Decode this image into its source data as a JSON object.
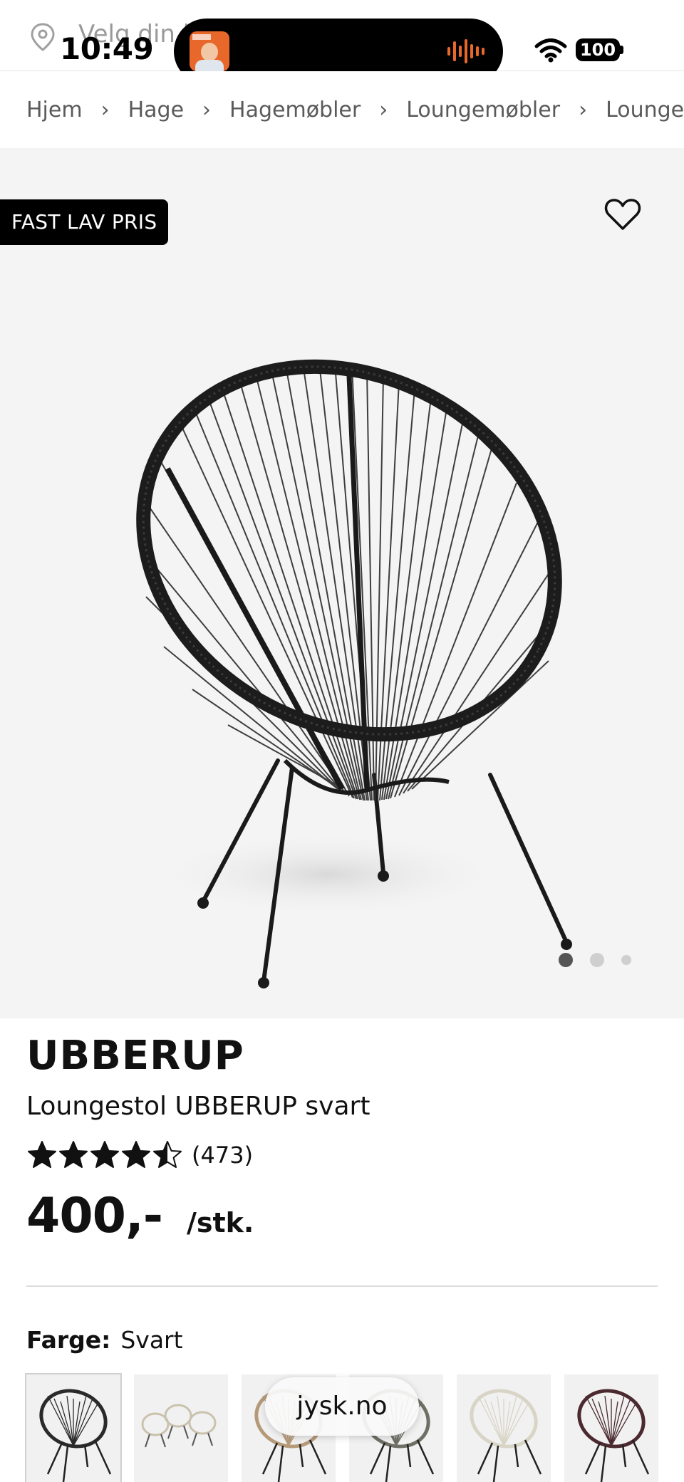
{
  "status_bar": {
    "time": "10:49",
    "battery": "100",
    "location_prompt": "Velg din b"
  },
  "breadcrumb": [
    "Hjem",
    "Hage",
    "Hagemøbler",
    "Loungemøbler",
    "Loungestoler"
  ],
  "breadcrumb_separator": "›",
  "hero": {
    "badge": "FAST LAV PRIS",
    "image_count": 3,
    "active_image": 1,
    "icons": [
      "heart-outline-icon",
      "location-pin-icon"
    ]
  },
  "product": {
    "brand": "UBBERUP",
    "name": "Loungestol UBBERUP svart",
    "rating": 4.5,
    "rating_max": 5,
    "review_count": "(473)",
    "price": "400,-",
    "unit": "/stk."
  },
  "color": {
    "label": "Farge:",
    "value": "Svart",
    "swatches": [
      {
        "name": "Svart",
        "color": "#2a2a2a"
      },
      {
        "name": "Sett",
        "color": "#c9c2ad"
      },
      {
        "name": "Natur",
        "color": "#b59a7a"
      },
      {
        "name": "Grå",
        "color": "#6f6f66"
      },
      {
        "name": "Hvit",
        "color": "#d8d4c6"
      },
      {
        "name": "Bordeaux",
        "color": "#4a2a30"
      }
    ]
  },
  "browser": {
    "url": "jysk.no"
  },
  "colors": {
    "accent": "#000000",
    "hero_bg": "#f4f4f4",
    "divider": "#dcdcdc",
    "island_art": "#e8672b"
  }
}
